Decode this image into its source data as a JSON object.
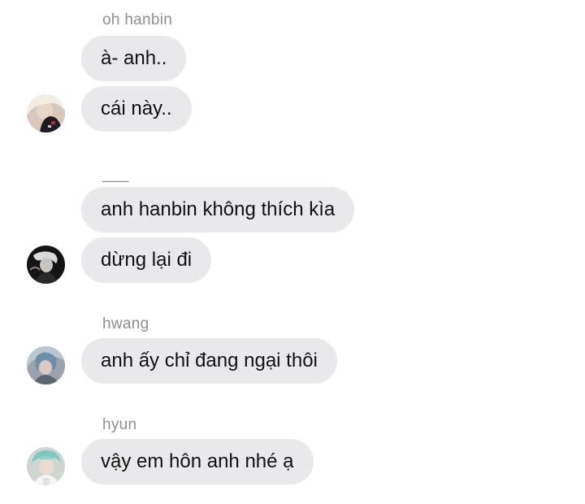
{
  "groups": [
    {
      "sender": "oh hanbin",
      "avatar_icon": "avatar-blonde-dark-jacket",
      "messages": [
        "à- anh..",
        "cái này.."
      ]
    },
    {
      "sender": "___",
      "avatar_icon": "avatar-silver-hair-dark",
      "messages": [
        "anh hanbin không thích kìa",
        "dừng lại đi"
      ]
    },
    {
      "sender": "hwang",
      "avatar_icon": "avatar-blue-hair",
      "messages": [
        "anh ấy chỉ đang ngại thôi"
      ]
    },
    {
      "sender": "hyun",
      "avatar_icon": "avatar-teal-hair",
      "messages": [
        "vậy em hôn anh nhé ạ"
      ]
    }
  ],
  "colors": {
    "bubble_bg": "#e9e9eb",
    "sender_text": "#8e8e93",
    "message_text": "#111111",
    "background": "#ffffff"
  }
}
